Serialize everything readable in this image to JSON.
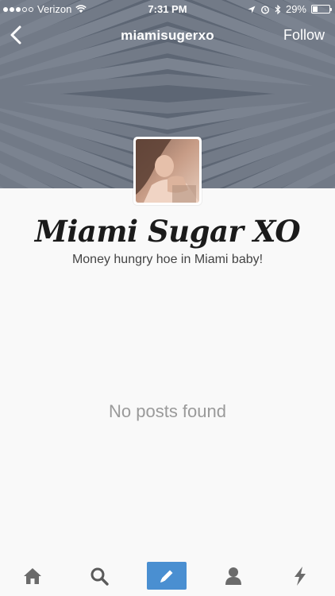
{
  "status_bar": {
    "carrier": "Verizon",
    "signal_bars_filled": 3,
    "signal_bars_total": 5,
    "time": "7:31 PM",
    "battery": "29%",
    "battery_level": 0.29
  },
  "nav": {
    "title": "miamisugerxo",
    "follow_label": "Follow"
  },
  "profile": {
    "blog_title": "Miami Sugar XO",
    "description": "Money hungry hoe in Miami baby!"
  },
  "content": {
    "empty_message": "No posts found"
  },
  "colors": {
    "header_bg": "#5c6574",
    "compose_accent": "#4a8fd1",
    "tab_icon": "#6b6b6b"
  },
  "tab_bar": {
    "items": [
      "home-icon",
      "search-icon",
      "compose-pencil-icon",
      "account-icon",
      "activity-lightning-icon"
    ]
  }
}
